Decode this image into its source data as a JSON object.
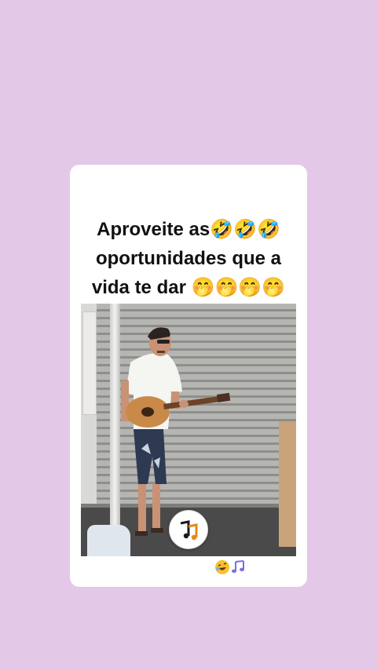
{
  "post": {
    "caption_lines": [
      "Aproveite as🤣🤣🤣",
      "oportunidades que a",
      "vida te dar 🤭🤭🤭🤭"
    ],
    "footer_emoji": [
      "rolling-laughing-emoji",
      "musical-notes-emoji"
    ]
  },
  "colors": {
    "page_background": "#e3c9e7",
    "card_background": "#ffffff",
    "caption_text": "#111111",
    "logo_accent": "#e58a16"
  },
  "video": {
    "watermark_icon": "music-note-logo-icon"
  }
}
